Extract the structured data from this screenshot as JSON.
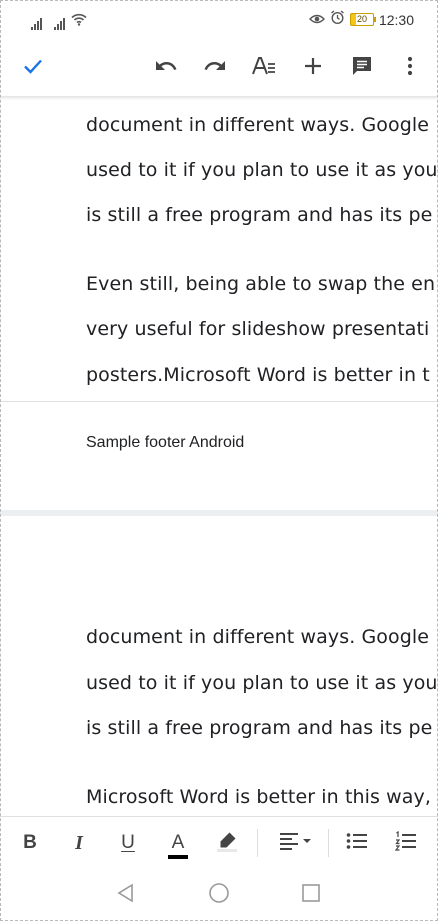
{
  "status_bar": {
    "time": "12:30",
    "battery_level": "20",
    "icons": [
      "signal-icon",
      "signal-icon",
      "wifi-icon",
      "eye-comfort-icon",
      "alarm-icon",
      "battery-icon"
    ]
  },
  "toolbar": {
    "icons": [
      "check-icon",
      "undo-icon",
      "redo-icon",
      "text-format-icon",
      "insert-icon",
      "comment-icon",
      "more-options-icon"
    ],
    "accent_color": "#1a73e8"
  },
  "document": {
    "page1_lines": [
      "document in different ways. Google",
      "used to it if you plan to use it as you",
      "is still a free program and has its pe",
      "Even still, being able to swap the en",
      "very useful for slideshow presentati",
      "posters.Microsoft Word is better in t"
    ],
    "footer_text": "Sample footer Android",
    "page2_lines": [
      "document in different ways. Google",
      "used to it if you plan to use it as you",
      "is still a free program and has its pe",
      "Microsoft Word is better in this way,"
    ]
  },
  "format_bar": {
    "bold_label": "B",
    "italic_label": "I",
    "underline_label": "U",
    "text_color_label": "A",
    "text_color": "#000000",
    "icons": [
      "bold-icon",
      "italic-icon",
      "underline-icon",
      "text-color-icon",
      "highlight-icon",
      "align-icon",
      "bulleted-list-icon",
      "numbered-list-icon"
    ]
  },
  "nav_bar": {
    "icons": [
      "back-icon",
      "home-icon",
      "recents-icon"
    ]
  }
}
